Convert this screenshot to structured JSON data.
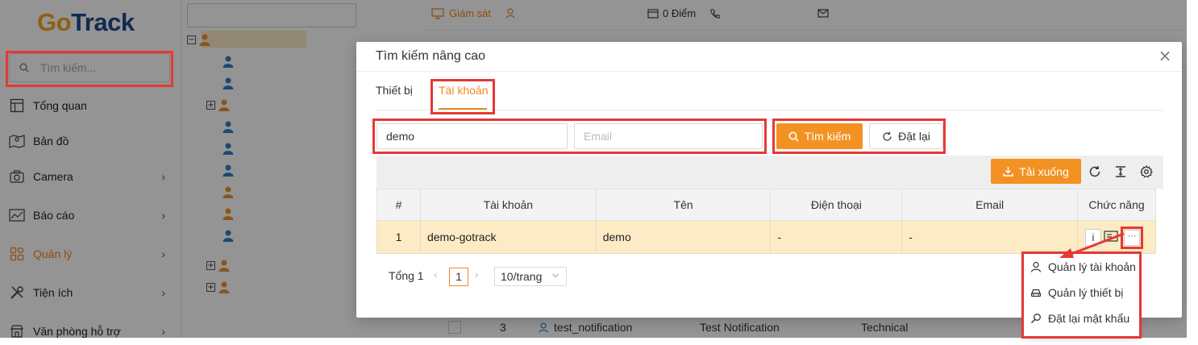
{
  "brand": {
    "logo_text_go": "Go",
    "logo_text_track": "Track"
  },
  "sidebar": {
    "search_placeholder": "Tìm kiếm...",
    "items": [
      {
        "label": "Tổng quan",
        "icon": "layout-icon",
        "has_arrow": false
      },
      {
        "label": "Bản đồ",
        "icon": "map-icon",
        "has_arrow": false
      },
      {
        "label": "Camera",
        "icon": "camera-icon",
        "has_arrow": true
      },
      {
        "label": "Báo cáo",
        "icon": "chart-icon",
        "has_arrow": true
      },
      {
        "label": "Quản lý",
        "icon": "apps-icon",
        "has_arrow": true,
        "active": true
      },
      {
        "label": "Tiện ích",
        "icon": "tools-icon",
        "has_arrow": true
      },
      {
        "label": "Văn phòng hỗ trợ",
        "icon": "store-icon",
        "has_arrow": true
      }
    ],
    "arrow_glyph": "›"
  },
  "topbar": {
    "monitor_label": "Giám sát",
    "points_label": "0 Điểm"
  },
  "background_row": {
    "index": "3",
    "account": "test_notification",
    "name": "Test Notification",
    "role": "Technical"
  },
  "modal": {
    "title": "Tìm kiếm nâng cao",
    "close_glyph": "×",
    "tabs": [
      {
        "label": "Thiết bị"
      },
      {
        "label": "Tài khoản",
        "active": true
      }
    ],
    "search": {
      "account_value": "demo",
      "account_placeholder": "",
      "email_value": "",
      "email_placeholder": "Email",
      "search_button": "Tìm kiếm",
      "reset_button": "Đặt lại"
    },
    "toolbar": {
      "download_button": "Tải xuống"
    },
    "table": {
      "columns": [
        "#",
        "Tài khoản",
        "Tên",
        "Điện thoại",
        "Email",
        "Chức năng"
      ],
      "rows": [
        {
          "index": "1",
          "account": "demo-gotrack",
          "name": "demo",
          "phone": "-",
          "email": "-"
        }
      ],
      "action_info": "i",
      "action_more": "···"
    },
    "pagination": {
      "total_label": "Tổng 1",
      "prev_glyph": "‹",
      "current_page": "1",
      "next_glyph": "›",
      "page_size": "10/trang"
    },
    "dropdown": {
      "items": [
        {
          "label": "Quản lý tài khoản",
          "icon": "user-icon"
        },
        {
          "label": "Quản lý thiết bị",
          "icon": "car-icon"
        },
        {
          "label": "Đặt lại mật khẩu",
          "icon": "key-icon"
        }
      ]
    }
  },
  "colors": {
    "accent": "#f39222",
    "active_text": "#f0891c",
    "annotation_red": "#e53935",
    "highlight_row": "#fdebc6",
    "logo_blue": "#1e4a8a",
    "user_blue": "#2f80c9",
    "user_orange": "#e8962a"
  }
}
